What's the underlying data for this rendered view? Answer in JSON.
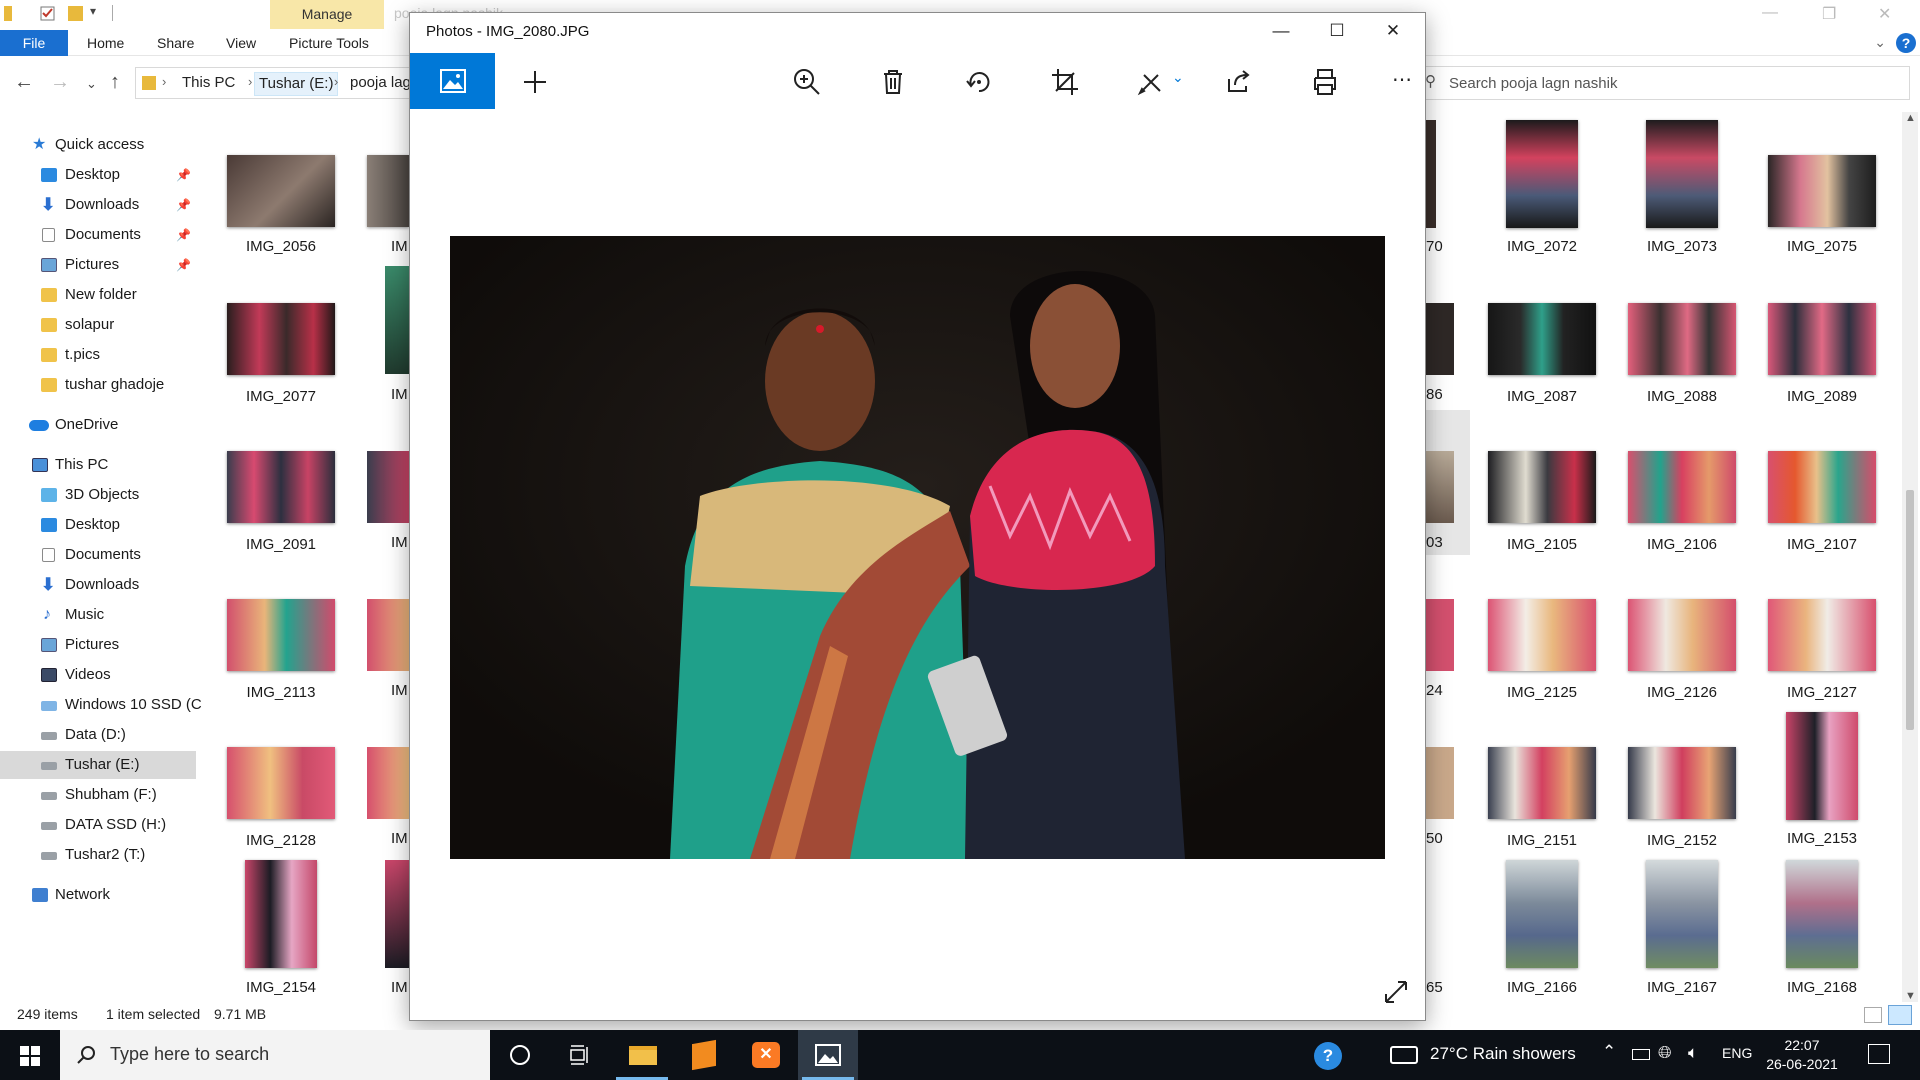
{
  "explorer": {
    "ribbon": {
      "manage_label": "Manage",
      "file_tab": "File",
      "tabs": [
        "Home",
        "Share",
        "View",
        "Picture Tools"
      ],
      "faded_title": "pooja lagn nashik"
    },
    "address": {
      "crumbs": [
        "This PC",
        "Tushar (E:)",
        "pooja lag"
      ],
      "search_placeholder": "Search pooja lagn nashik"
    },
    "nav_pane": {
      "quick_access": "Quick access",
      "quick_items": [
        "Desktop",
        "Downloads",
        "Documents",
        "Pictures",
        "New folder",
        "solapur",
        "t.pics",
        "tushar ghadoje"
      ],
      "onedrive": "OneDrive",
      "this_pc": "This PC",
      "pc_items": [
        "3D Objects",
        "Desktop",
        "Documents",
        "Downloads",
        "Music",
        "Pictures",
        "Videos",
        "Windows 10 SSD (C",
        "Data (D:)",
        "Tushar (E:)",
        "Shubham (F:)",
        "DATA SSD (H:)",
        "Tushar2 (T:)"
      ],
      "network": "Network"
    },
    "files_left": [
      "IMG_2056",
      "IMG_2077",
      "IMG_2091",
      "IMG_2113",
      "IMG_2128",
      "IMG_2154"
    ],
    "files_partial": [
      "IM",
      "IM",
      "IM",
      "IM",
      "IM",
      "IM"
    ],
    "files_right_col1_tail": [
      "70",
      "86",
      "03",
      "24",
      "50",
      "65"
    ],
    "files_right": [
      [
        "IMG_2072",
        "IMG_2073",
        "IMG_2075"
      ],
      [
        "IMG_2087",
        "IMG_2088",
        "IMG_2089"
      ],
      [
        "IMG_2105",
        "IMG_2106",
        "IMG_2107"
      ],
      [
        "IMG_2125",
        "IMG_2126",
        "IMG_2127"
      ],
      [
        "IMG_2151",
        "IMG_2152",
        "IMG_2153"
      ],
      [
        "IMG_2166",
        "IMG_2167",
        "IMG_2168"
      ]
    ],
    "status": {
      "count": "249 items",
      "selected": "1 item selected",
      "size": "9.71 MB"
    }
  },
  "photos": {
    "title": "Photos - IMG_2080.JPG",
    "tools": [
      "view-toggle",
      "add",
      "zoom",
      "delete",
      "rotate",
      "crop",
      "edit",
      "share",
      "print",
      "more"
    ]
  },
  "taskbar": {
    "search_placeholder": "Type here to search",
    "weather": "27°C  Rain showers",
    "language": "ENG",
    "time": "22:07",
    "date": "26-06-2021"
  },
  "colors": {
    "accent": "#0078d7",
    "taskbar": "#0c1016",
    "manage_tab": "#f8e7a8"
  }
}
